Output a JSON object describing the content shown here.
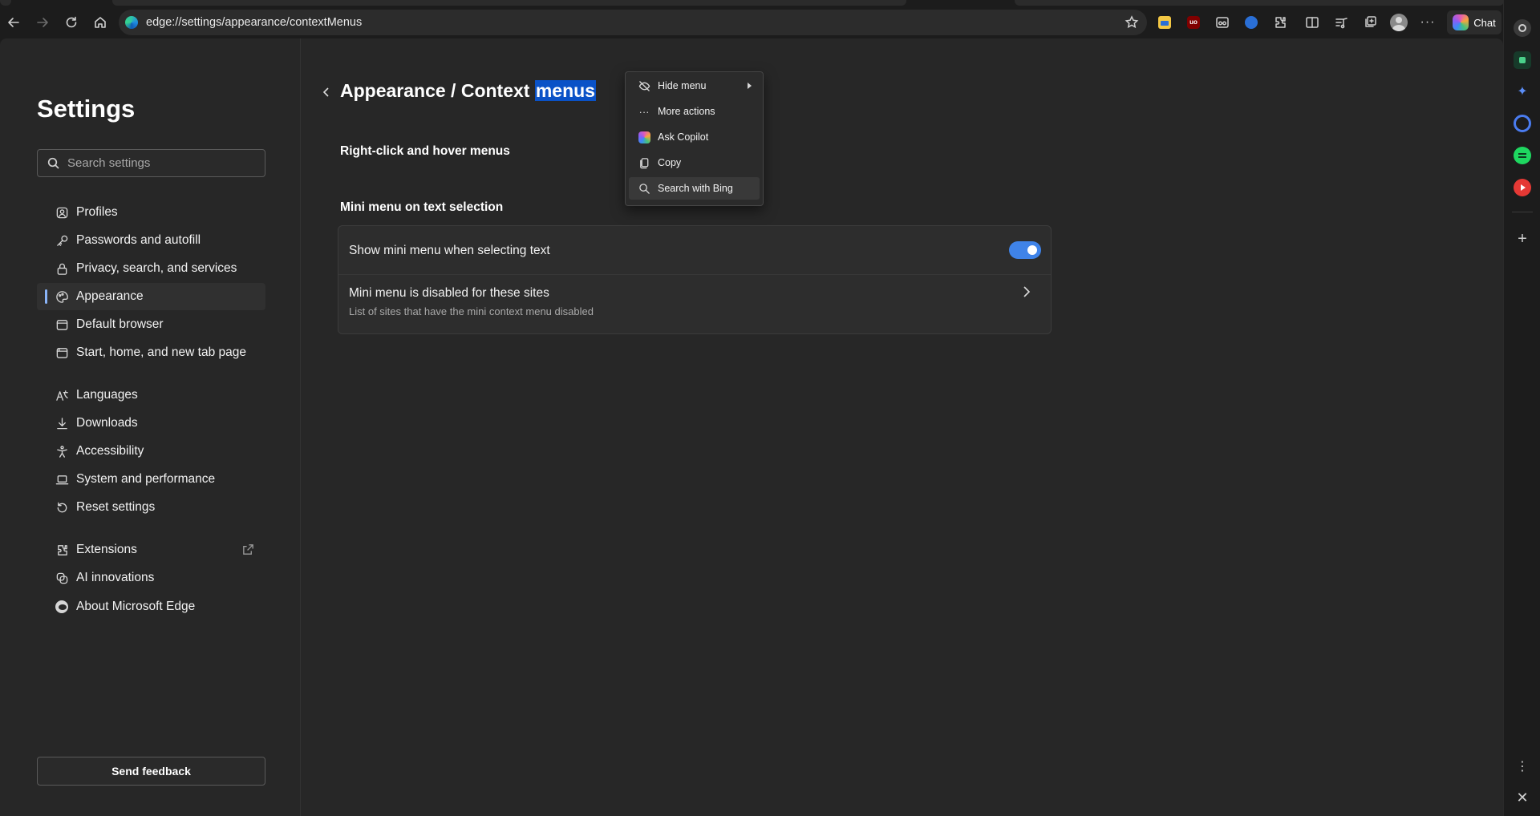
{
  "browser": {
    "address_url": "edge://settings/appearance/contextMenus",
    "chat_label": "Chat"
  },
  "sidebar": {
    "title": "Settings",
    "search_placeholder": "Search settings",
    "items": [
      {
        "label": "Profiles",
        "icon": "profile-icon"
      },
      {
        "label": "Passwords and autofill",
        "icon": "key-icon"
      },
      {
        "label": "Privacy, search, and services",
        "icon": "lock-icon"
      },
      {
        "label": "Appearance",
        "icon": "palette-icon"
      },
      {
        "label": "Default browser",
        "icon": "browser-icon"
      },
      {
        "label": "Start, home, and new tab page",
        "icon": "home-page-icon"
      },
      {
        "label": "Languages",
        "icon": "languages-icon"
      },
      {
        "label": "Downloads",
        "icon": "download-icon"
      },
      {
        "label": "Accessibility",
        "icon": "accessibility-icon"
      },
      {
        "label": "System and performance",
        "icon": "laptop-icon"
      },
      {
        "label": "Reset settings",
        "icon": "reset-icon"
      },
      {
        "label": "Extensions",
        "icon": "extensions-icon"
      },
      {
        "label": "AI innovations",
        "icon": "ai-icon"
      },
      {
        "label": "About Microsoft Edge",
        "icon": "edge-icon"
      }
    ],
    "active_item": "Appearance",
    "feedback_label": "Send feedback"
  },
  "content": {
    "breadcrumb_prefix": "Appearance / Context ",
    "breadcrumb_selected": "menus",
    "section1_title": "Right-click and hover menus",
    "section2_title": "Mini menu on text selection",
    "row1_label": "Show mini menu when selecting text",
    "row1_toggle": "on",
    "row2_title": "Mini menu is disabled for these sites",
    "row2_subtitle": "List of sites that have the mini context menu disabled"
  },
  "mini_menu": {
    "items": [
      {
        "label": "Hide menu",
        "icon": "hide-icon",
        "has_submenu": true
      },
      {
        "label": "More actions",
        "icon": "more-icon"
      },
      {
        "label": "Ask Copilot",
        "icon": "copilot-icon"
      },
      {
        "label": "Copy",
        "icon": "copy-icon"
      },
      {
        "label": "Search with Bing",
        "icon": "search-icon",
        "hovered": true
      }
    ]
  },
  "colors": {
    "accent": "#3f83e8",
    "selection": "#0a52c7",
    "page_bg": "#272727"
  }
}
